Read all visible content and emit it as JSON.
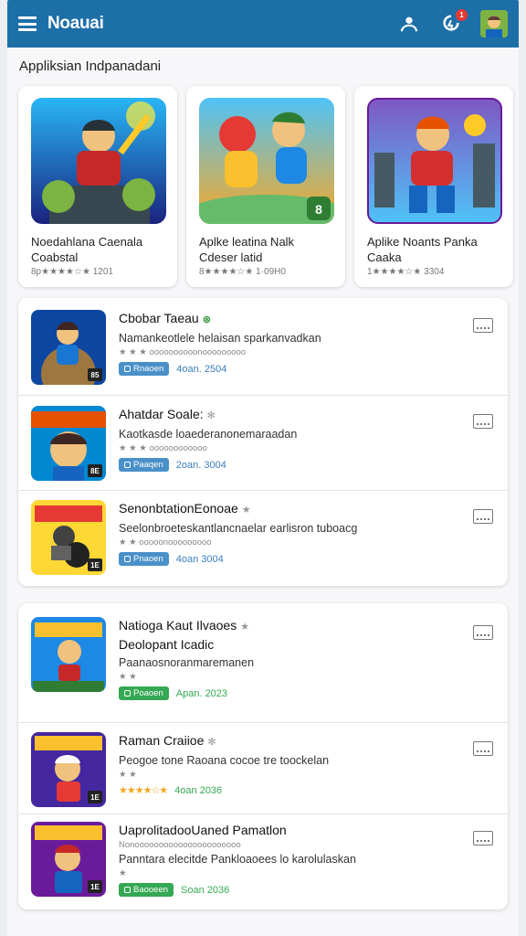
{
  "header": {
    "title": "Noauai",
    "badge_count": "1"
  },
  "section": {
    "title": "Appliksian Indpanadani"
  },
  "featured": [
    {
      "name": "Noedahlana Caenala Coabstal",
      "rating": "★★★★",
      "meta": "8p★★★★☆★ 1201"
    },
    {
      "name": "Aplke leatina Nalk Cdeser latid",
      "rating": "★★★★",
      "meta": "8★★★★☆★ 1·09H0"
    },
    {
      "name": "Aplike Noants Panka Caaka",
      "rating": "★★★★",
      "meta": "1★★★★☆★ 3304"
    }
  ],
  "list1": [
    {
      "title": "Cbobar Taeau",
      "mark": "⊛",
      "desc": "Namankeotlele helaisan sparkanvadkan",
      "sub": "★ ★ ★ oooooooooonooooooooo",
      "pill": "Rnaoen",
      "date": "4oan. 2504",
      "rank": "85"
    },
    {
      "title": "Ahatdar Soale:",
      "mark": "✻",
      "desc": "Kaotkasde loaederanonemaraadan",
      "sub": "★ ★ ★ oooooooooooo",
      "pill": "Paaqen",
      "date": "2oan. 3004",
      "rank": "8E"
    },
    {
      "title": "SenonbtationEonoae",
      "mark": "★",
      "desc": "Seelonbroeteskantlancnaelar earlisron tuboacg",
      "sub": "★ ★ ooooonooooooooo",
      "pill": "Pnaoen",
      "date": "4oan 3004",
      "rank": "1E"
    }
  ],
  "list2": [
    {
      "title": "Natioga Kaut Ilvaoes",
      "mark": "★",
      "title2": "Deolopant Icadic",
      "desc": "Paanaosnoranmaremanen",
      "sub": "★ ★",
      "pill": "Poaoen",
      "date": "Apan. 2023",
      "rank": ""
    },
    {
      "title": "Raman Craiioe",
      "mark": "✻",
      "desc": "Peogoe tone Raoana cocoe tre toockelan",
      "sub": "★ ★",
      "pill": "",
      "stars": "★★★★☆★",
      "date": "4oan 2036",
      "rank": "1E"
    },
    {
      "title": "Uaprolitadoo⁠Uaned Pamatlon",
      "mark": "",
      "desc2": "Nonoooooooooooooooooooooo",
      "desc": "Panntara elecitde Pankloaoees lo karolulaskan",
      "sub": "★",
      "pill": "Baooeen",
      "date": "Soan 2036",
      "rank": "1E"
    }
  ]
}
